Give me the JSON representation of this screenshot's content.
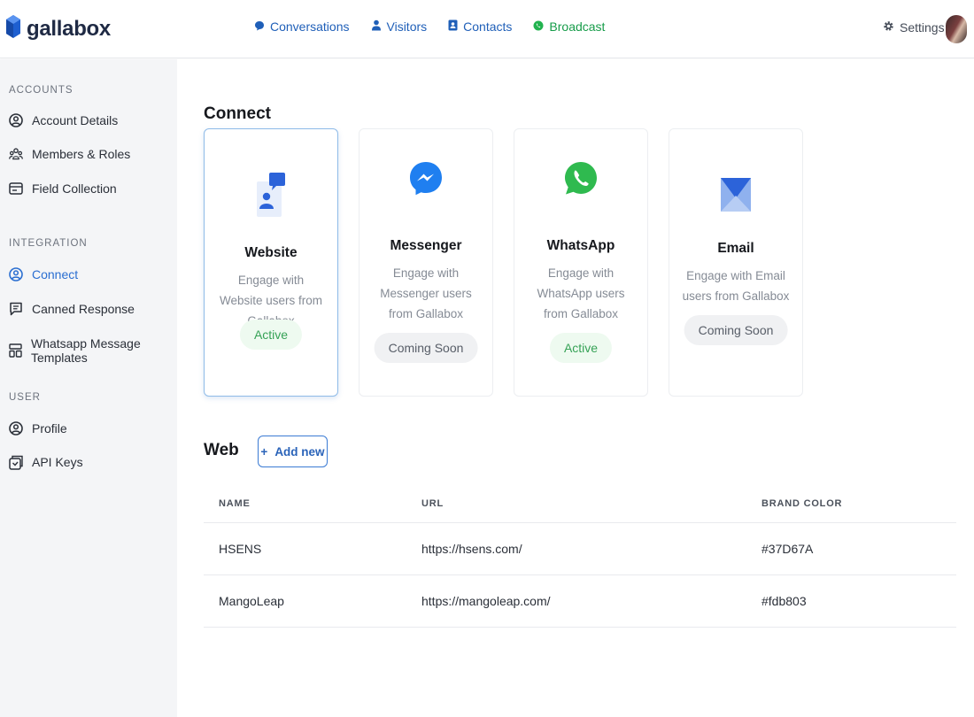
{
  "brand": {
    "name": "gallabox",
    "color": "#1e5fd0"
  },
  "nav": [
    {
      "label": "Conversations",
      "icon": "chat-bubble-icon"
    },
    {
      "label": "Visitors",
      "icon": "person-icon"
    },
    {
      "label": "Contacts",
      "icon": "contact-book-icon"
    },
    {
      "label": "Broadcast",
      "icon": "whatsapp-icon"
    }
  ],
  "settings": {
    "label": "Settings",
    "icon": "gear-icon"
  },
  "sidebar": {
    "accounts_title": "ACCOUNTS",
    "accounts": [
      {
        "label": "Account Details",
        "icon": "user-circle-icon"
      },
      {
        "label": "Members & Roles",
        "icon": "group-icon"
      },
      {
        "label": "Field Collection",
        "icon": "form-icon"
      }
    ],
    "integration_title": "INTEGRATION",
    "integration": [
      {
        "label": "Connect",
        "icon": "user-circle-icon",
        "active": true
      },
      {
        "label": "Canned Response",
        "icon": "message-icon"
      },
      {
        "label": "Whatsapp Message Templates",
        "icon": "template-icon"
      }
    ],
    "user_title": "USER",
    "user": [
      {
        "label": "Profile",
        "icon": "user-circle-icon"
      },
      {
        "label": "API Keys",
        "icon": "api-key-icon"
      }
    ]
  },
  "main": {
    "connect_title": "Connect",
    "cards": [
      {
        "title": "Website",
        "desc": "Engage with Website users from Gallabox",
        "status": "Active",
        "icon": "website-chat-icon"
      },
      {
        "title": "Messenger",
        "desc": "Engage with Messenger users from Gallabox",
        "status": "Coming Soon",
        "icon": "messenger-icon"
      },
      {
        "title": "WhatsApp",
        "desc": "Engage with WhatsApp users from Gallabox",
        "status": "Active",
        "icon": "whatsapp-icon"
      },
      {
        "title": "Email",
        "desc": "Engage with Email users from Gallabox",
        "status": "Coming Soon",
        "icon": "email-icon"
      }
    ],
    "web_title": "Web",
    "add_new": "Add new",
    "add_icon": "+",
    "table": {
      "headers": [
        "NAME",
        "URL",
        "BRAND COLOR"
      ],
      "rows": [
        {
          "name": "HSENS",
          "url": "https://hsens.com/",
          "color": "#37D67A"
        },
        {
          "name": "MangoLeap",
          "url": "https://mangoleap.com/",
          "color": "#fdb803"
        }
      ]
    }
  }
}
